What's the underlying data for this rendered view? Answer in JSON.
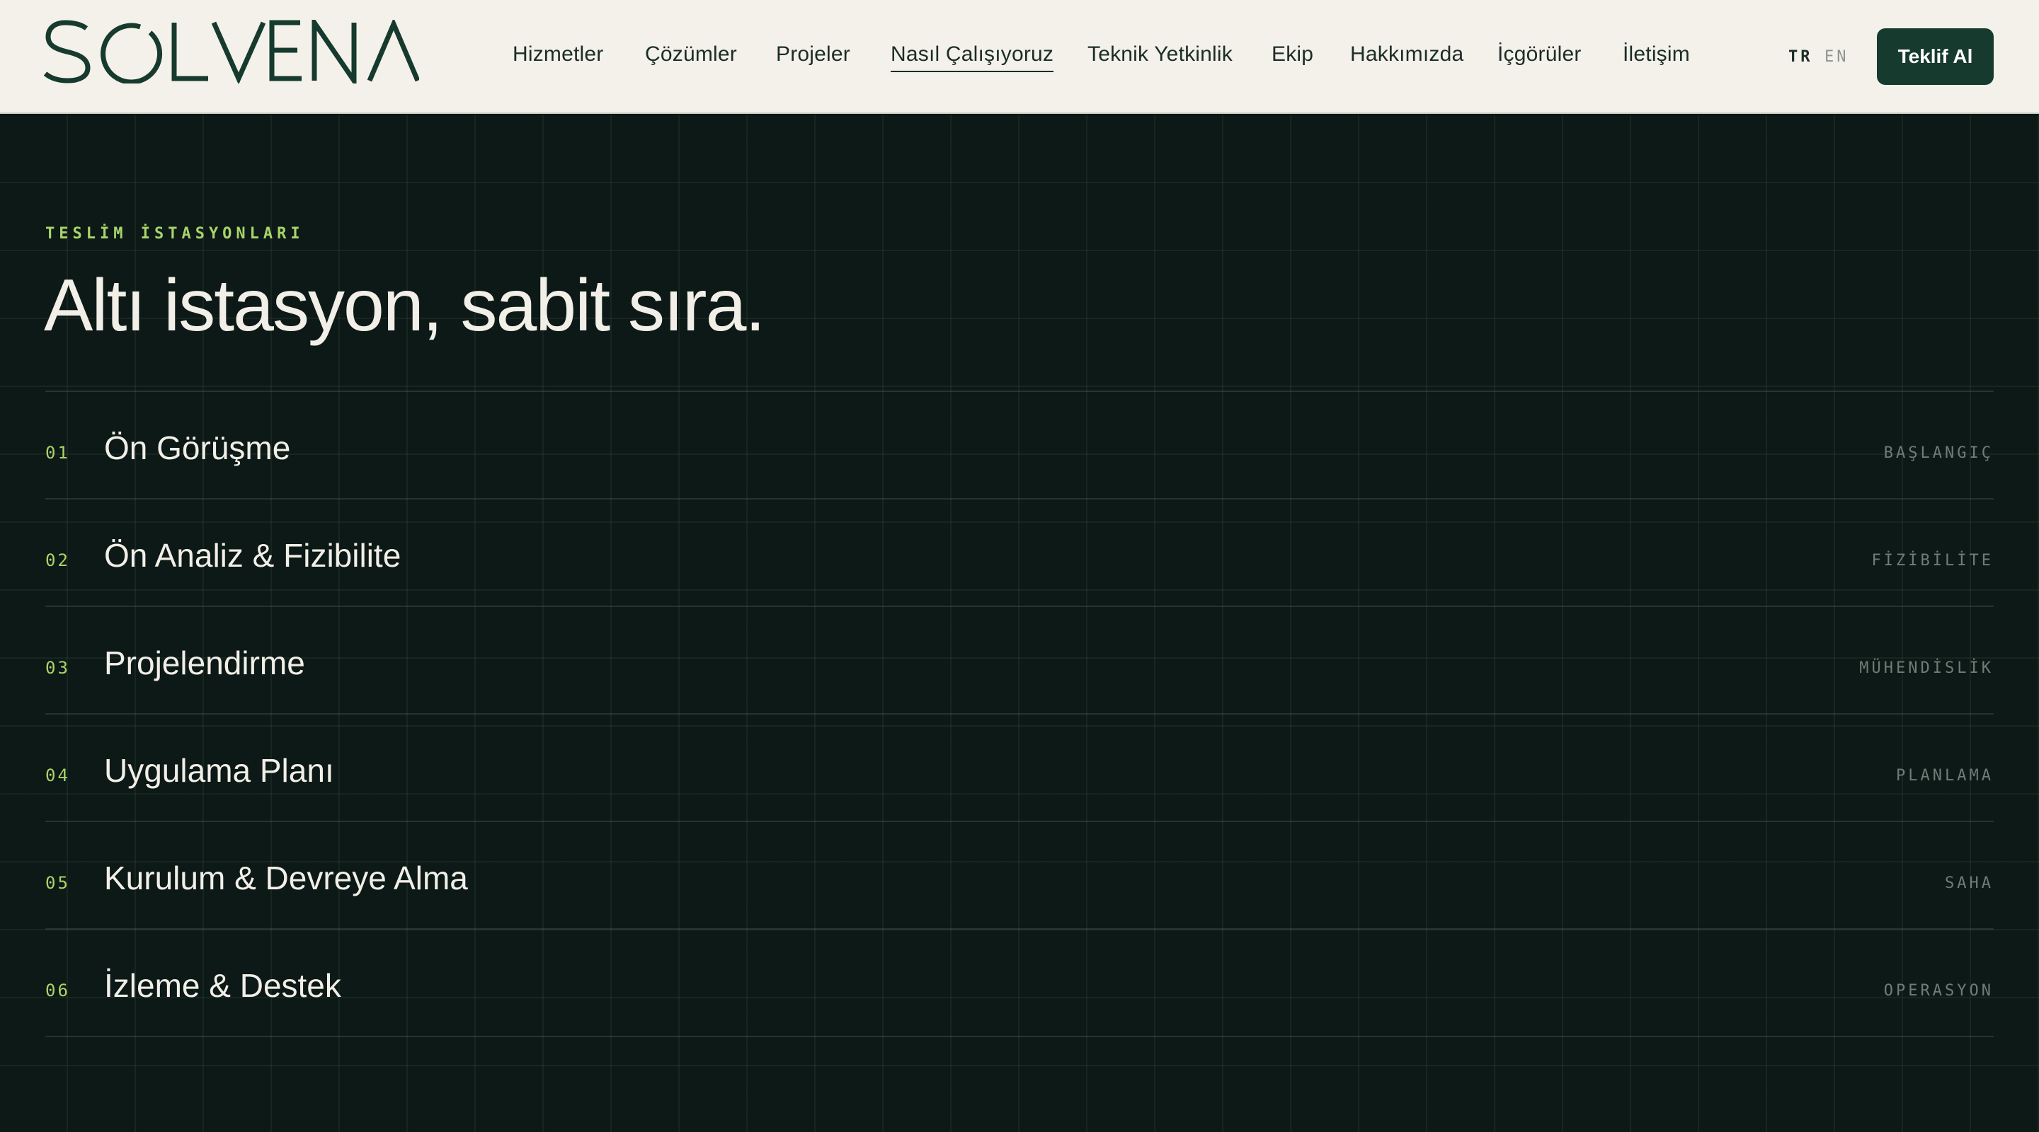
{
  "brand": {
    "logo_text": "SOLVENA"
  },
  "nav": {
    "items": [
      {
        "label": "Hizmetler"
      },
      {
        "label": "Çözümler"
      },
      {
        "label": "Projeler"
      },
      {
        "label": "Nasıl Çalışıyoruz",
        "active": true
      },
      {
        "label": "Teknik Yetkinlik"
      },
      {
        "label": "Ekip"
      },
      {
        "label": "Hakkımızda"
      },
      {
        "label": "İçgörüler"
      },
      {
        "label": "İletişim"
      }
    ]
  },
  "lang": {
    "tr": "TR",
    "en": "EN"
  },
  "cta": {
    "label": "Teklif Al"
  },
  "section": {
    "eyebrow": "TESLİM İSTASYONLARI",
    "title": "Altı istasyon, sabit sıra.",
    "stations": [
      {
        "num": "01",
        "title": "Ön Görüşme",
        "tag": "BAŞLANGIÇ"
      },
      {
        "num": "02",
        "title": "Ön Analiz & Fizibilite",
        "tag": "FİZİBİLİTE"
      },
      {
        "num": "03",
        "title": "Projelendirme",
        "tag": "MÜHENDİSLİK"
      },
      {
        "num": "04",
        "title": "Uygulama Planı",
        "tag": "PLANLAMA"
      },
      {
        "num": "05",
        "title": "Kurulum & Devreye Alma",
        "tag": "SAHA"
      },
      {
        "num": "06",
        "title": "İzleme & Destek",
        "tag": "OPERASYON"
      }
    ]
  },
  "colors": {
    "header_bg": "#f3f1ea",
    "dark_bg": "#0d1916",
    "accent": "#a9d46a",
    "cta_bg": "#163a2d",
    "brand": "#163a2d"
  }
}
